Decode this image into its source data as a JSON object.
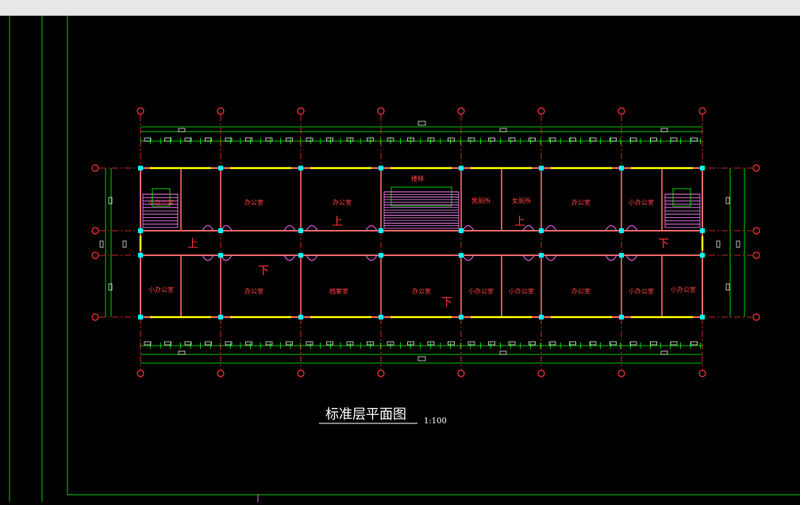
{
  "drawing": {
    "title": "标准层平面图",
    "scale": "1:100"
  },
  "rooms": [
    {
      "label": "小办公室"
    },
    {
      "label": "办公室"
    },
    {
      "label": "办公室"
    },
    {
      "label": "楼梯"
    },
    {
      "label": "男厕所"
    },
    {
      "label": "女厕所"
    },
    {
      "label": "办公室"
    },
    {
      "label": "小办公室"
    },
    {
      "label": "小办公室"
    },
    {
      "label": "办公室"
    },
    {
      "label": "档案室"
    },
    {
      "label": "办公室"
    },
    {
      "label": "小办公室"
    },
    {
      "label": "小办公室"
    },
    {
      "label": "办公室"
    },
    {
      "label": "小办公室"
    },
    {
      "label": "小办公室"
    }
  ],
  "stair_marks": [
    "上",
    "下"
  ],
  "colors": {
    "background": "#000000",
    "frame": "#00ff00",
    "axis": "#ff3333",
    "wall": "#ff6666",
    "column": "#00ffff",
    "window": "#ffff00",
    "dimension": "#00ff00",
    "text": "#ffffff"
  }
}
